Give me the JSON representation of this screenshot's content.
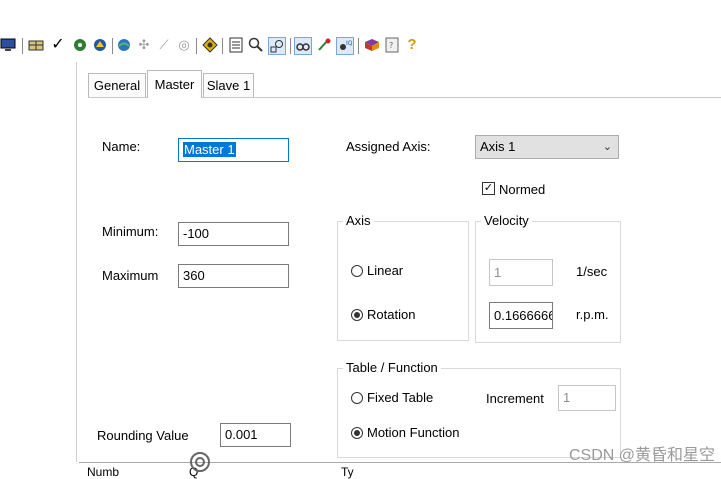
{
  "toolbar": {
    "icons": [
      {
        "name": "monitor-icon",
        "glyph": "🖥"
      },
      {
        "name": "grid-icon",
        "glyph": "☷"
      },
      {
        "name": "check-icon",
        "glyph": "✓"
      },
      {
        "name": "tool-icon",
        "glyph": "⚙"
      },
      {
        "name": "gear-cam-icon",
        "glyph": "⚙"
      },
      {
        "name": "globe-icon",
        "glyph": "◉"
      },
      {
        "name": "network-icon",
        "glyph": "✣"
      },
      {
        "name": "wand-icon",
        "glyph": "⟋"
      },
      {
        "name": "target-icon",
        "glyph": "◎"
      },
      {
        "name": "diamond-icon",
        "glyph": "◆"
      },
      {
        "name": "list-icon",
        "glyph": "▤"
      },
      {
        "name": "search-icon",
        "glyph": "⚲"
      },
      {
        "name": "zoom-region-icon",
        "glyph": "⊡"
      },
      {
        "name": "binoculars-icon",
        "glyph": "∞"
      },
      {
        "name": "node-icon",
        "glyph": "✎"
      },
      {
        "name": "graph-icon",
        "glyph": "⋈"
      },
      {
        "name": "book-icon",
        "glyph": "▰"
      },
      {
        "name": "doc-icon",
        "glyph": "▣"
      },
      {
        "name": "help-icon",
        "glyph": "?"
      }
    ]
  },
  "tabs": [
    {
      "label": "General"
    },
    {
      "label": "Master"
    },
    {
      "label": "Slave 1"
    }
  ],
  "form": {
    "name_label": "Name:",
    "name_value": "Master 1",
    "minimum_label": "Minimum:",
    "minimum_value": "-100",
    "maximum_label": "Maximum",
    "maximum_value": "360",
    "rounding_label": "Rounding Value",
    "rounding_value": "0.001",
    "assigned_axis_label": "Assigned Axis:",
    "assigned_axis_value": "Axis 1",
    "normed_label": "Normed"
  },
  "axis_group": {
    "title": "Axis",
    "linear_label": "Linear",
    "rotation_label": "Rotation"
  },
  "velocity_group": {
    "title": "Velocity",
    "field1_value": "1",
    "field1_unit": "1/sec",
    "field2_value": "0.1666666",
    "field2_unit": "r.p.m."
  },
  "table_group": {
    "title": "Table / Function",
    "fixed_table_label": "Fixed Table",
    "motion_function_label": "Motion Function",
    "increment_label": "Increment",
    "increment_value": "1"
  },
  "bottom_header": {
    "col1": "Numb",
    "col2": "Q",
    "col3": "Ty"
  },
  "watermark": "CSDN @黄昏和星空"
}
